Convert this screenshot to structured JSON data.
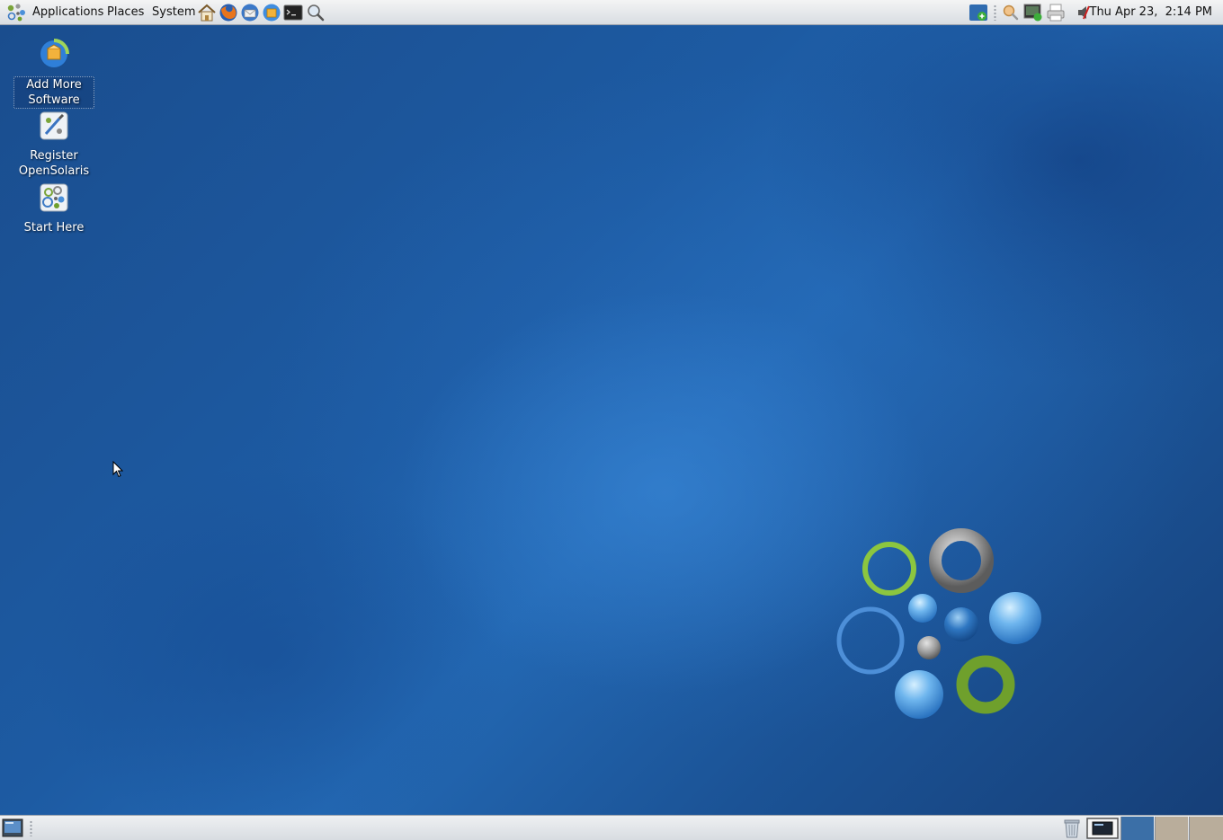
{
  "top_panel": {
    "menus": {
      "applications": "Applications",
      "places": "Places",
      "system": "System"
    },
    "launchers": [
      "home-icon",
      "firefox-icon",
      "thunderbird-icon",
      "software-icon",
      "terminal-icon",
      "search-icon"
    ],
    "tray": [
      "update-notifier-icon",
      "network-search-icon",
      "network-monitor-icon",
      "printer-icon",
      "volume-muted-icon"
    ],
    "clock": "Thu Apr 23,  2:14 PM"
  },
  "desktop": {
    "icons": [
      {
        "line1": "Add More",
        "line2": "Software",
        "icon": "package-manager-icon",
        "selected": true
      },
      {
        "line1": "Register",
        "line2": "OpenSolaris",
        "icon": "register-icon",
        "selected": false
      },
      {
        "line1": "Start Here",
        "line2": "",
        "icon": "start-here-icon",
        "selected": false
      }
    ]
  },
  "bottom_panel": {
    "show_desktop": "show-desktop-icon",
    "trash": "trash-icon",
    "workspaces": [
      "Workspace 1",
      "Workspace 2",
      "Workspace 3"
    ],
    "active_workspace": 1
  },
  "colors": {
    "wallpaper": "#1d5ba3",
    "panel": "#dfe2e6",
    "active_workspace": "#3b6fa7"
  }
}
